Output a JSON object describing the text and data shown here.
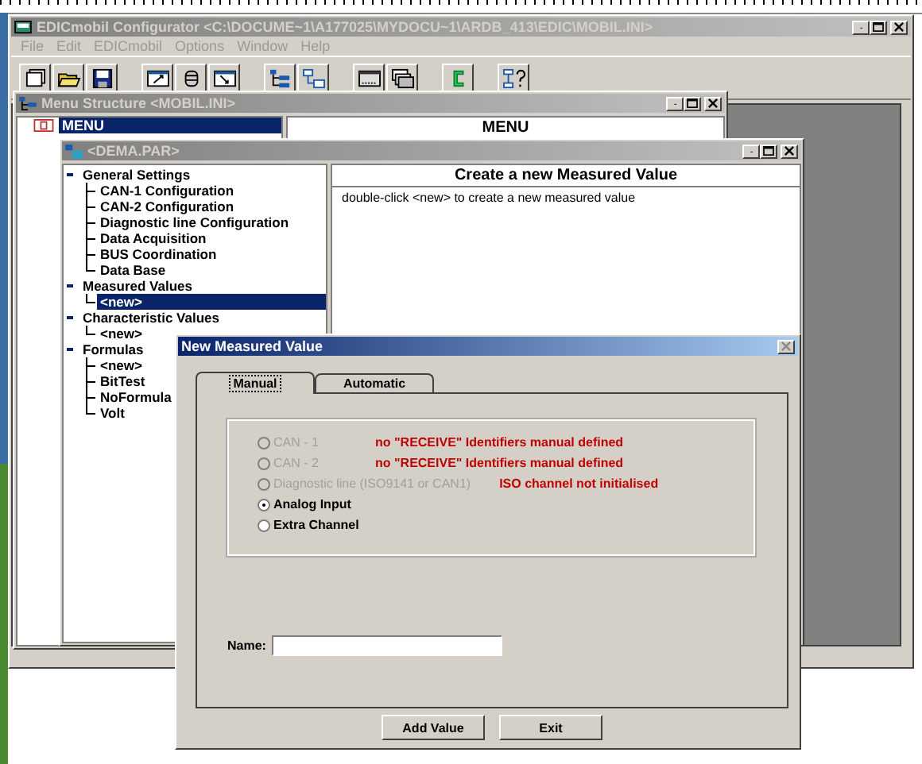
{
  "app_window": {
    "title": "EDICmobil Configurator <C:\\DOCUME~1\\A177025\\MYDOCU~1\\ARDB_413\\EDIC\\MOBIL.INI>",
    "menu": [
      "File",
      "Edit",
      "EDICmobil",
      "Options",
      "Window",
      "Help"
    ]
  },
  "menu_structure_window": {
    "title": "Menu Structure <MOBIL.INI>",
    "tree": [
      {
        "label": "MENU",
        "selected": true
      }
    ],
    "detail_header": "MENU"
  },
  "parameter_window": {
    "title": "<DEMA.PAR>",
    "tree": [
      {
        "label": "General Settings",
        "expanded": true,
        "selected": false,
        "children": [
          {
            "label": "CAN-1 Configuration",
            "selected": false
          },
          {
            "label": "CAN-2 Configuration",
            "selected": false
          },
          {
            "label": "Diagnostic line Configuration",
            "selected": false
          },
          {
            "label": "Data Acquisition",
            "selected": false
          },
          {
            "label": "BUS Coordination",
            "selected": false
          },
          {
            "label": "Data Base",
            "selected": false
          }
        ]
      },
      {
        "label": "Measured Values",
        "expanded": true,
        "selected": false,
        "children": [
          {
            "label": "<new>",
            "selected": true
          }
        ]
      },
      {
        "label": "Characteristic Values",
        "expanded": true,
        "selected": false,
        "children": [
          {
            "label": "<new>",
            "selected": false
          }
        ]
      },
      {
        "label": "Formulas",
        "expanded": true,
        "selected": false,
        "children": [
          {
            "label": "<new>",
            "selected": false
          },
          {
            "label": "BitTest",
            "selected": false
          },
          {
            "label": "NoFormula",
            "selected": false
          },
          {
            "label": "Volt",
            "selected": false
          }
        ]
      }
    ],
    "detail_header": "Create a new Measured Value",
    "detail_text": "double-click <new> to create a new measured value"
  },
  "dialog": {
    "title": "New Measured Value",
    "tabs": [
      {
        "label": "Manual",
        "selected": true
      },
      {
        "label": "Automatic",
        "selected": false
      }
    ],
    "sources": [
      {
        "label": "CAN - 1",
        "disabled": true,
        "selected": false,
        "note": "no \"RECEIVE\" Identifiers manual defined"
      },
      {
        "label": "CAN - 2",
        "disabled": true,
        "selected": false,
        "note": "no \"RECEIVE\" Identifiers manual defined"
      },
      {
        "label": "Diagnostic line (ISO9141 or CAN1)",
        "disabled": true,
        "selected": false,
        "note": "ISO channel not initialised"
      },
      {
        "label": "Analog Input",
        "disabled": false,
        "selected": true
      },
      {
        "label": "Extra Channel",
        "disabled": false,
        "selected": false
      }
    ],
    "name_label": "Name:",
    "buttons": [
      "Add Value",
      "Exit"
    ]
  }
}
